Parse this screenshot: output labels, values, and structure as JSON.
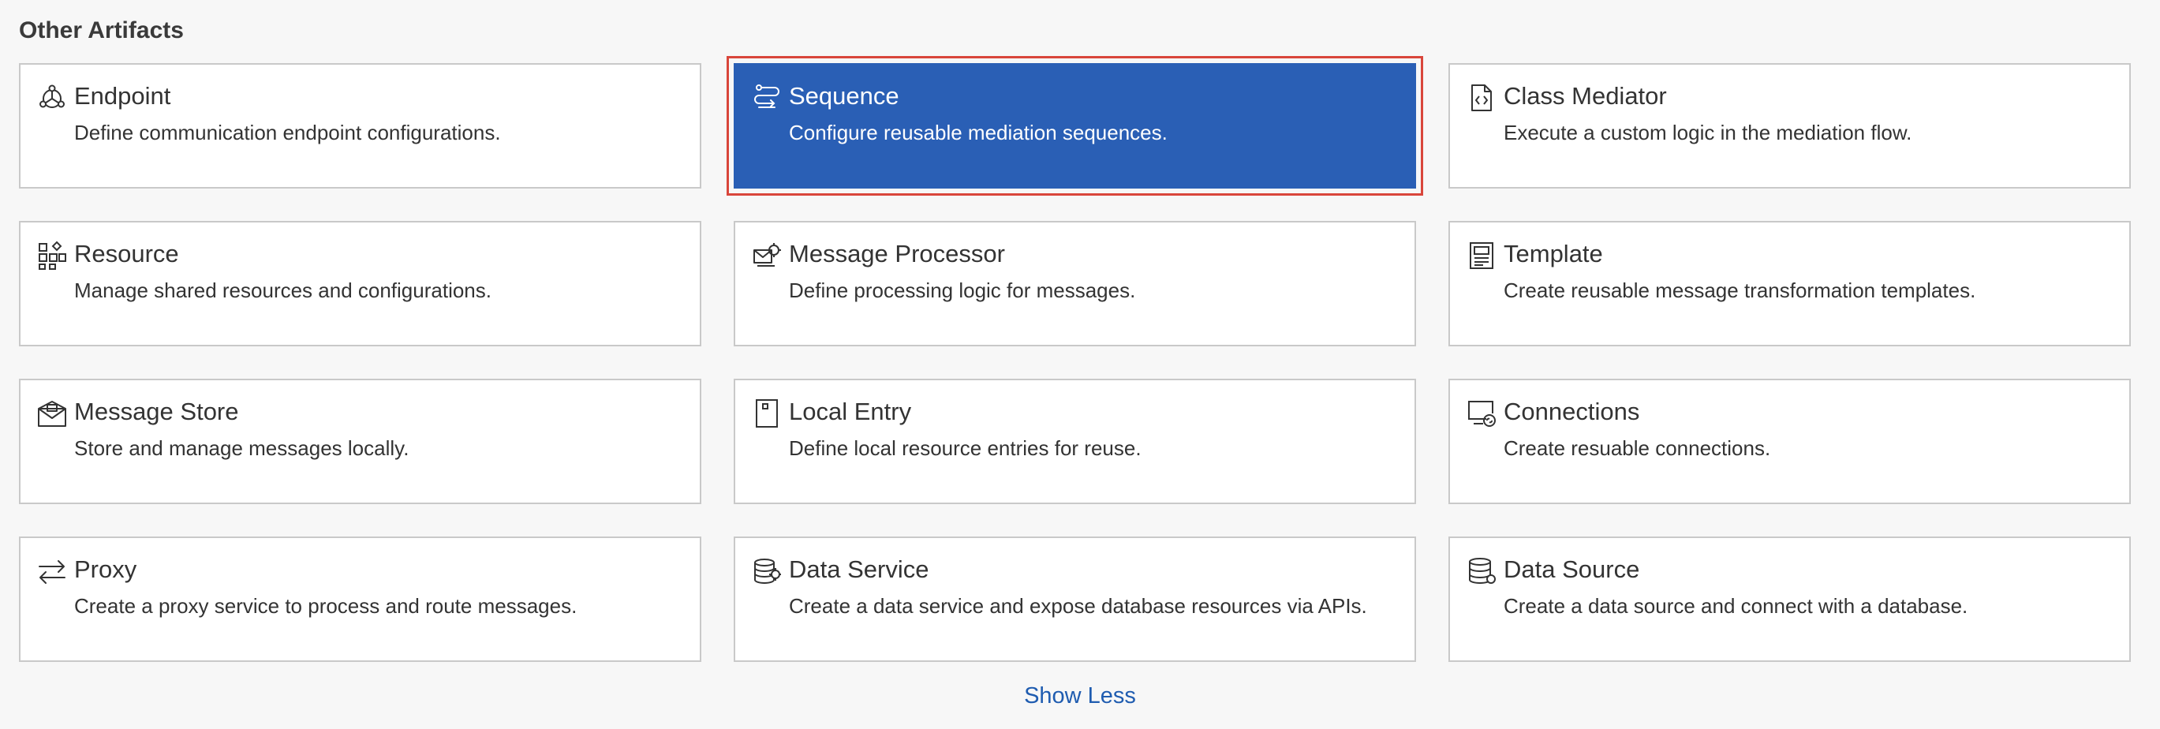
{
  "section": {
    "title": "Other Artifacts"
  },
  "cards": [
    {
      "title": "Endpoint",
      "description": "Define communication endpoint configurations.",
      "icon": "endpoint-icon"
    },
    {
      "title": "Sequence",
      "description": "Configure reusable mediation sequences.",
      "icon": "sequence-icon",
      "selected": true
    },
    {
      "title": "Class Mediator",
      "description": "Execute a custom logic in the mediation flow.",
      "icon": "class-mediator-icon"
    },
    {
      "title": "Resource",
      "description": "Manage shared resources and configurations.",
      "icon": "resource-icon"
    },
    {
      "title": "Message Processor",
      "description": "Define processing logic for messages.",
      "icon": "message-processor-icon"
    },
    {
      "title": "Template",
      "description": "Create reusable message transformation templates.",
      "icon": "template-icon"
    },
    {
      "title": "Message Store",
      "description": "Store and manage messages locally.",
      "icon": "message-store-icon"
    },
    {
      "title": "Local Entry",
      "description": "Define local resource entries for reuse.",
      "icon": "local-entry-icon"
    },
    {
      "title": "Connections",
      "description": "Create resuable connections.",
      "icon": "connections-icon"
    },
    {
      "title": "Proxy",
      "description": "Create a proxy service to process and route messages.",
      "icon": "proxy-icon"
    },
    {
      "title": "Data Service",
      "description": "Create a data service and expose database resources via APIs.",
      "icon": "data-service-icon"
    },
    {
      "title": "Data Source",
      "description": "Create a data source and connect with a database.",
      "icon": "data-source-icon"
    }
  ],
  "footer": {
    "show_less_label": "Show Less"
  },
  "colors": {
    "selected_bg": "#2a5fb5",
    "selected_outline": "#d9463b",
    "link": "#1f5cb0"
  }
}
